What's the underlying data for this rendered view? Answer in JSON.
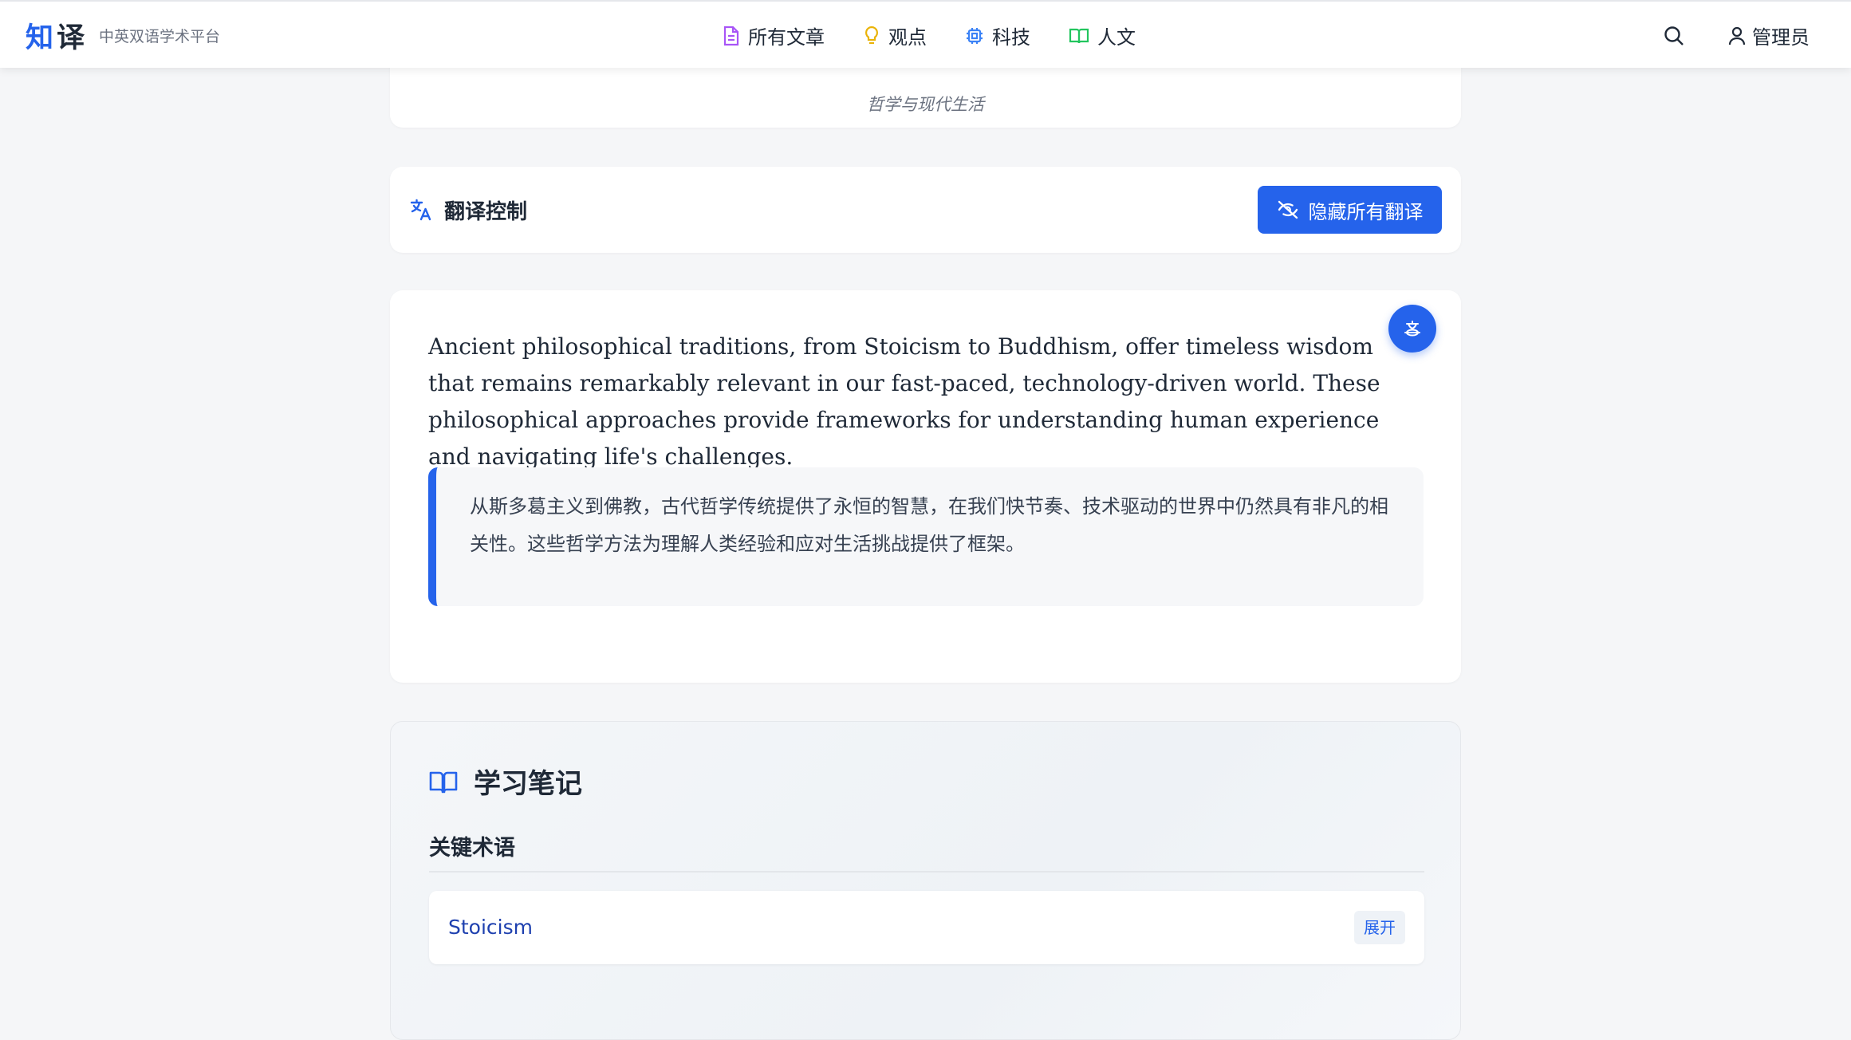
{
  "brand": {
    "logo_1": "知",
    "logo_2": "译",
    "tagline": "中英双语学术平台"
  },
  "nav": {
    "items": [
      {
        "label": "所有文章",
        "icon": "document-icon",
        "color": "#a855f7"
      },
      {
        "label": "观点",
        "icon": "lightbulb-icon",
        "color": "#eab308"
      },
      {
        "label": "科技",
        "icon": "chip-icon",
        "color": "#3b82f6"
      },
      {
        "label": "人文",
        "icon": "open-book-icon",
        "color": "#22c55e"
      }
    ],
    "user_label": "管理员"
  },
  "article": {
    "subtitle": "哲学与现代生活"
  },
  "translation_control": {
    "title": "翻译控制",
    "hide_all_label": "隐藏所有翻译"
  },
  "paragraph": {
    "english": "Ancient philosophical traditions, from Stoicism to Buddhism, offer timeless wisdom that remains remarkably relevant in our fast-paced, technology-driven world. These philosophical approaches provide frameworks for understanding human experience and navigating life's challenges.",
    "chinese": "从斯多葛主义到佛教，古代哲学传统提供了永恒的智慧，在我们快节奏、技术驱动的世界中仍然具有非凡的相关性。这些哲学方法为理解人类经验和应对生活挑战提供了框架。"
  },
  "notes": {
    "title": "学习笔记",
    "key_terms_title": "关键术语",
    "terms": [
      {
        "name": "Stoicism",
        "toggle_label": "展开"
      }
    ]
  },
  "colors": {
    "accent": "#2563eb",
    "background": "#f5f6f8"
  }
}
